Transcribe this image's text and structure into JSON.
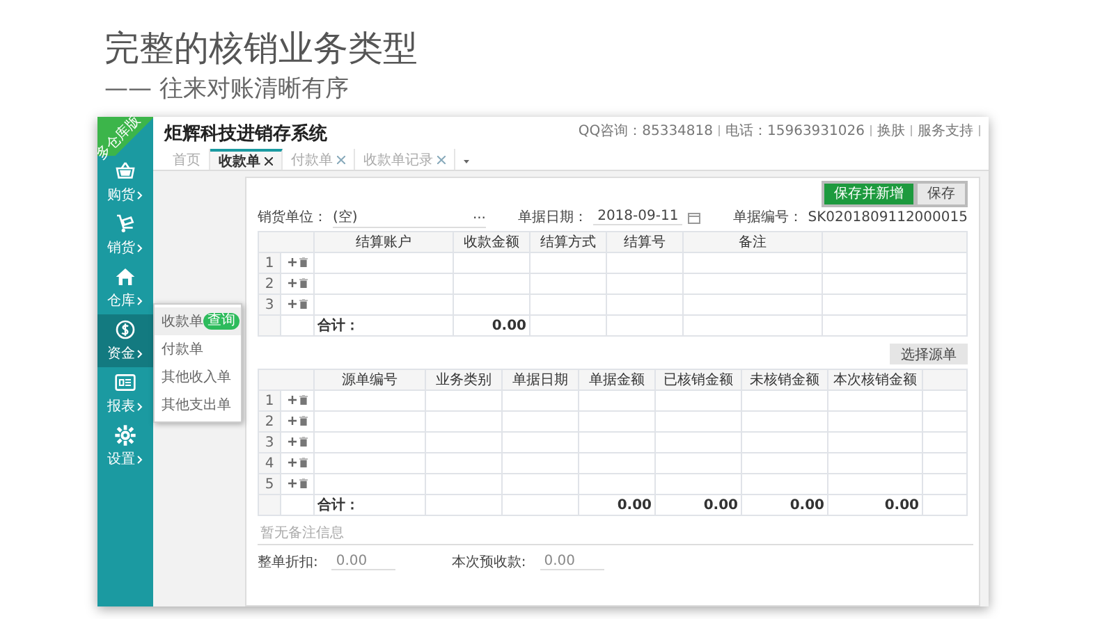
{
  "headline": "完整的核销业务类型",
  "subheadline": "—— 往来对账清晰有序",
  "app": {
    "ribbon": "多仓库版",
    "title": "炬辉科技进销存系统",
    "header_links": [
      "QQ咨询：85334818",
      "电话：15963931026",
      "换肤",
      "服务支持"
    ],
    "tabs": [
      {
        "label": "首页",
        "closable": false,
        "selected": false
      },
      {
        "label": "收款单",
        "closable": true,
        "selected": true
      },
      {
        "label": "付款单",
        "closable": true,
        "selected": false
      },
      {
        "label": "收款单记录",
        "closable": true,
        "selected": false
      }
    ],
    "sidebar": {
      "items": [
        {
          "label": "购货",
          "selected": false
        },
        {
          "label": "销货",
          "selected": false
        },
        {
          "label": "仓库",
          "selected": false
        },
        {
          "label": "资金",
          "selected": true
        },
        {
          "label": "报表",
          "selected": false
        },
        {
          "label": "设置",
          "selected": false
        }
      ]
    },
    "submenu": {
      "items": [
        {
          "label": "收款单",
          "badge": "查询",
          "selected": true
        },
        {
          "label": "付款单",
          "selected": false
        },
        {
          "label": "其他收入单",
          "selected": false
        },
        {
          "label": "其他支出单",
          "selected": false
        }
      ]
    },
    "buttons": [
      {
        "label": "保存并新增",
        "kind": "primary"
      },
      {
        "label": "保存",
        "kind": "default"
      }
    ],
    "form": {
      "unit_label": "销货单位：",
      "unit_value": "(空)",
      "unit_more": "...",
      "date_label": "单据日期：",
      "date_value": "2018-09-11",
      "number_label": "单据编号：",
      "number_value": "SK0201809112000015"
    },
    "settlement_table": {
      "columns": [
        {
          "label": "结算账户"
        },
        {
          "label": "收款金额",
          "total": "0.00"
        },
        {
          "label": "结算方式"
        },
        {
          "label": "结算号"
        },
        {
          "label": "备注"
        }
      ],
      "rows": [
        "1",
        "2",
        "3"
      ],
      "total_label": "合计："
    },
    "source_button": "选择源单",
    "source_table": {
      "columns": [
        {
          "label": "源单编号"
        },
        {
          "label": "业务类别"
        },
        {
          "label": "单据日期"
        },
        {
          "label": "单据金额",
          "total": "0.00"
        },
        {
          "label": "已核销金额",
          "total": "0.00"
        },
        {
          "label": "未核销金额",
          "total": "0.00"
        },
        {
          "label": "本次核销金额",
          "total": "0.00"
        }
      ],
      "rows": [
        "1",
        "2",
        "3",
        "4",
        "5"
      ],
      "total_label": "合计："
    },
    "note": {
      "placeholder": "暂无备注信息"
    },
    "footer_fields": [
      {
        "label": "整单折扣:",
        "value": "0.00"
      },
      {
        "label": "本次预收款:",
        "value": "0.00"
      }
    ]
  }
}
